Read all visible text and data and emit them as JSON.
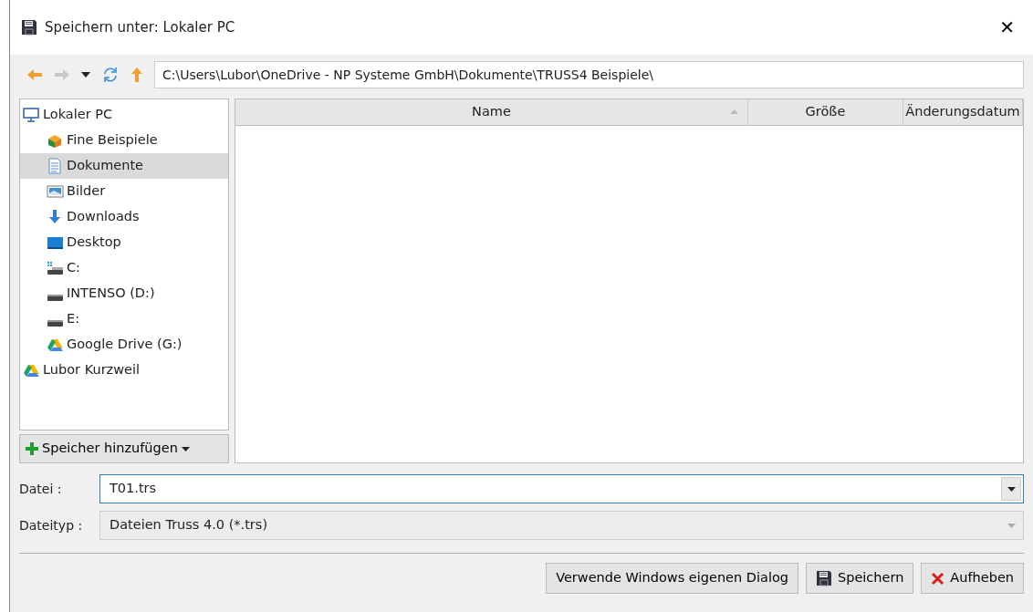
{
  "window": {
    "title": "Speichern unter: Lokaler PC",
    "close": "✕"
  },
  "toolbar": {
    "back": {
      "disabled": false
    },
    "forward": {
      "disabled": true
    },
    "path": "C:\\Users\\Lubor\\OneDrive - NP Systeme GmbH\\Dokumente\\TRUSS4 Beispiele\\"
  },
  "sidebar": {
    "items": [
      {
        "label": "Lokaler PC",
        "kind": "computer",
        "selected": false,
        "children": [
          {
            "label": "Fine Beispiele",
            "kind": "cube",
            "selected": false
          },
          {
            "label": "Dokumente",
            "kind": "document",
            "selected": true
          },
          {
            "label": "Bilder",
            "kind": "picture",
            "selected": false
          },
          {
            "label": "Downloads",
            "kind": "download",
            "selected": false
          },
          {
            "label": "Desktop",
            "kind": "desktop",
            "selected": false
          },
          {
            "label": "C:",
            "kind": "system-drive",
            "selected": false
          },
          {
            "label": "INTENSO (D:)",
            "kind": "drive",
            "selected": false
          },
          {
            "label": "E:",
            "kind": "drive",
            "selected": false
          },
          {
            "label": "Google Drive (G:)",
            "kind": "cloud",
            "selected": false
          }
        ]
      },
      {
        "label": "Lubor Kurzweil",
        "kind": "cloud",
        "selected": false
      }
    ],
    "add_button": "Speicher hinzufügen"
  },
  "table": {
    "columns": [
      {
        "label": "Name",
        "sorted": true
      },
      {
        "label": "Größe",
        "sorted": false
      },
      {
        "label": "Änderungsdatum",
        "sorted": false
      }
    ]
  },
  "file_name": {
    "label": "Datei :",
    "value": "T01.trs"
  },
  "file_type": {
    "label": "Dateityp :",
    "value": "Dateien Truss 4.0 (*.trs)",
    "disabled": true
  },
  "buttons": [
    {
      "label": "Verwende Windows eigenen Dialog",
      "kind": "plain"
    },
    {
      "label": "Speichern",
      "kind": "save"
    },
    {
      "label": "Aufheben",
      "kind": "cancel"
    }
  ]
}
